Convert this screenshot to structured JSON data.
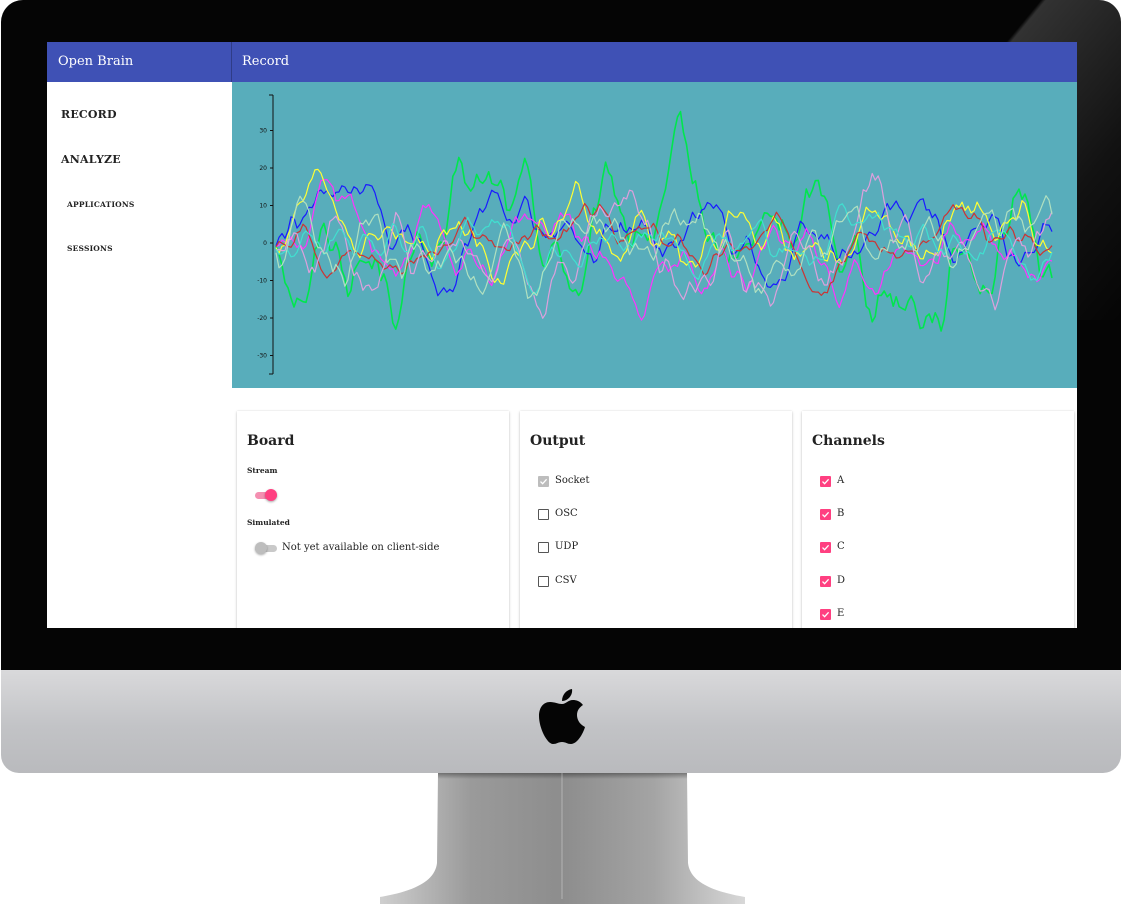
{
  "app": {
    "title": "Open Brain",
    "page_title": "Record"
  },
  "sidebar": {
    "items": [
      {
        "label": "RECORD"
      },
      {
        "label": "ANALYZE"
      },
      {
        "label": "APPLICATIONS"
      },
      {
        "label": "SESSIONS"
      }
    ]
  },
  "chart": {
    "y_ticks": [
      "30",
      "20",
      "10",
      "0",
      "-10",
      "-20",
      "-30"
    ],
    "background": "#58adbb"
  },
  "chart_data": {
    "type": "line",
    "title": "",
    "xlabel": "",
    "ylabel": "",
    "ylim": [
      -35,
      40
    ],
    "yticks": [
      30,
      20,
      10,
      0,
      -10,
      -20,
      -30
    ],
    "series": [
      {
        "color": "#00e64d",
        "amplitude": 10
      },
      {
        "color": "#1a1aff",
        "amplitude": 6
      },
      {
        "color": "#ff33ff",
        "amplitude": 6
      },
      {
        "color": "#ffff33",
        "amplitude": 6
      },
      {
        "color": "#cc3333",
        "amplitude": 4
      },
      {
        "color": "#dda0dd",
        "amplitude": 7
      },
      {
        "color": "#40e0d0",
        "amplitude": 5
      },
      {
        "color": "#b0e0c0",
        "amplitude": 7
      }
    ]
  },
  "board": {
    "title": "Board",
    "stream_label": "Stream",
    "stream_on": true,
    "simulated_label": "Simulated",
    "simulated_on": false,
    "simulated_note": "Not yet available on client-side"
  },
  "output": {
    "title": "Output",
    "options": [
      {
        "label": "Socket",
        "checked": true,
        "disabled": true
      },
      {
        "label": "OSC",
        "checked": false
      },
      {
        "label": "UDP",
        "checked": false
      },
      {
        "label": "CSV",
        "checked": false
      }
    ]
  },
  "channels": {
    "title": "Channels",
    "items": [
      {
        "label": "A",
        "checked": true
      },
      {
        "label": "B",
        "checked": true
      },
      {
        "label": "C",
        "checked": true
      },
      {
        "label": "D",
        "checked": true
      },
      {
        "label": "E",
        "checked": true
      }
    ]
  }
}
